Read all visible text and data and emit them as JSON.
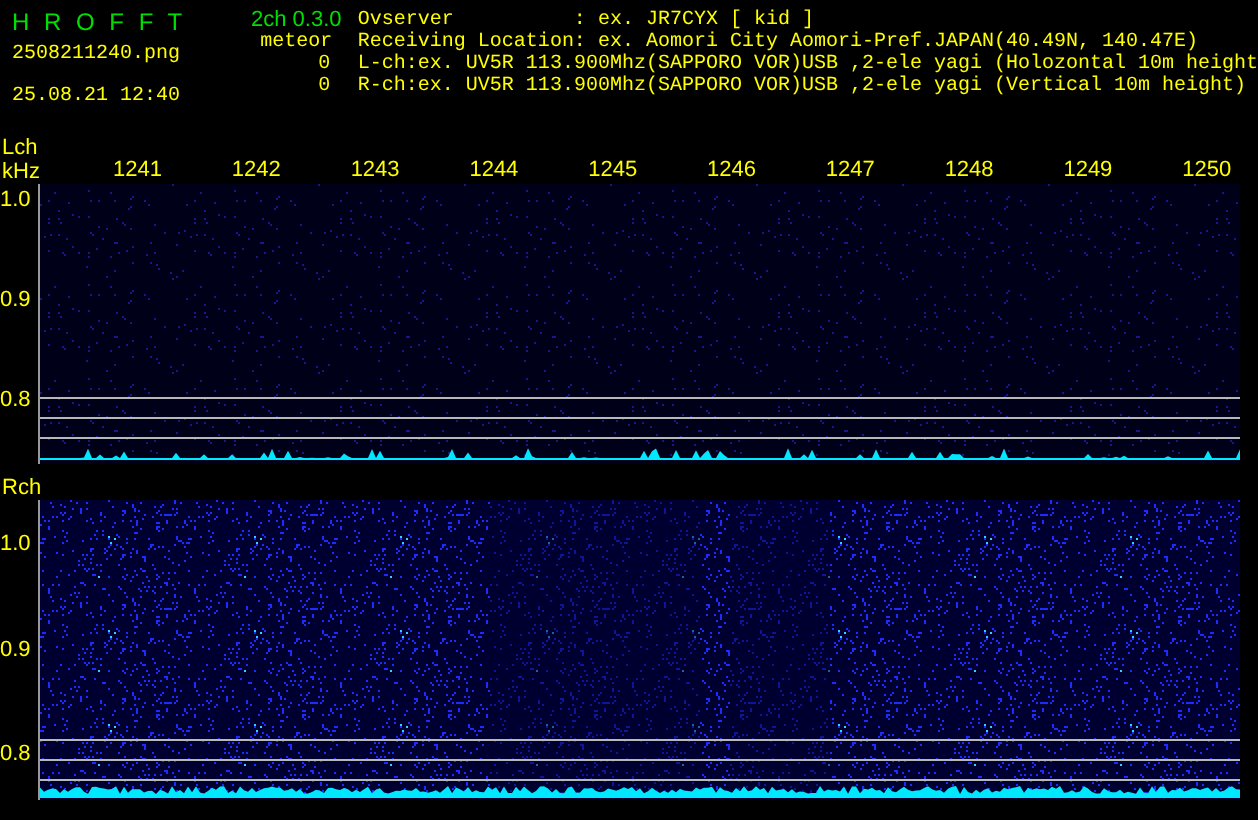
{
  "app": {
    "logo": "H R O F F T",
    "version": "2ch 0.3.0",
    "filename": "2508211240.png",
    "datetime": "25.08.21 12:40"
  },
  "meteor": {
    "label": "meteor",
    "lch_count": "0",
    "rch_count": "0"
  },
  "info": [
    {
      "kind": "field",
      "label": "Ovserver",
      "separator": ":",
      "value": "ex. JR7CYX [ kid ]"
    },
    {
      "kind": "field",
      "label": "Receiving Location",
      "separator": ":",
      "value": "ex. Aomori City Aomori-Pref.JAPAN(40.49N, 140.47E)"
    },
    {
      "kind": "line",
      "text": "L-ch:ex. UV5R 113.900Mhz(SAPPORO VOR)USB ,2-ele yagi (Holozontal 10m height"
    },
    {
      "kind": "line",
      "text": "R-ch:ex. UV5R 113.900Mhz(SAPPORO VOR)USB ,2-ele yagi (Vertical 10m height)"
    }
  ],
  "panels": [
    {
      "channel": "Lch",
      "unit": "kHz",
      "x_labels": [
        "1241",
        "1242",
        "1243",
        "1244",
        "1245",
        "1246",
        "1247",
        "1248",
        "1249",
        "1250"
      ],
      "y_labels": [
        "1.0",
        "0.9",
        "0.8"
      ]
    },
    {
      "channel": "Rch",
      "y_labels": [
        "1.0",
        "0.9",
        "0.8"
      ]
    }
  ]
}
